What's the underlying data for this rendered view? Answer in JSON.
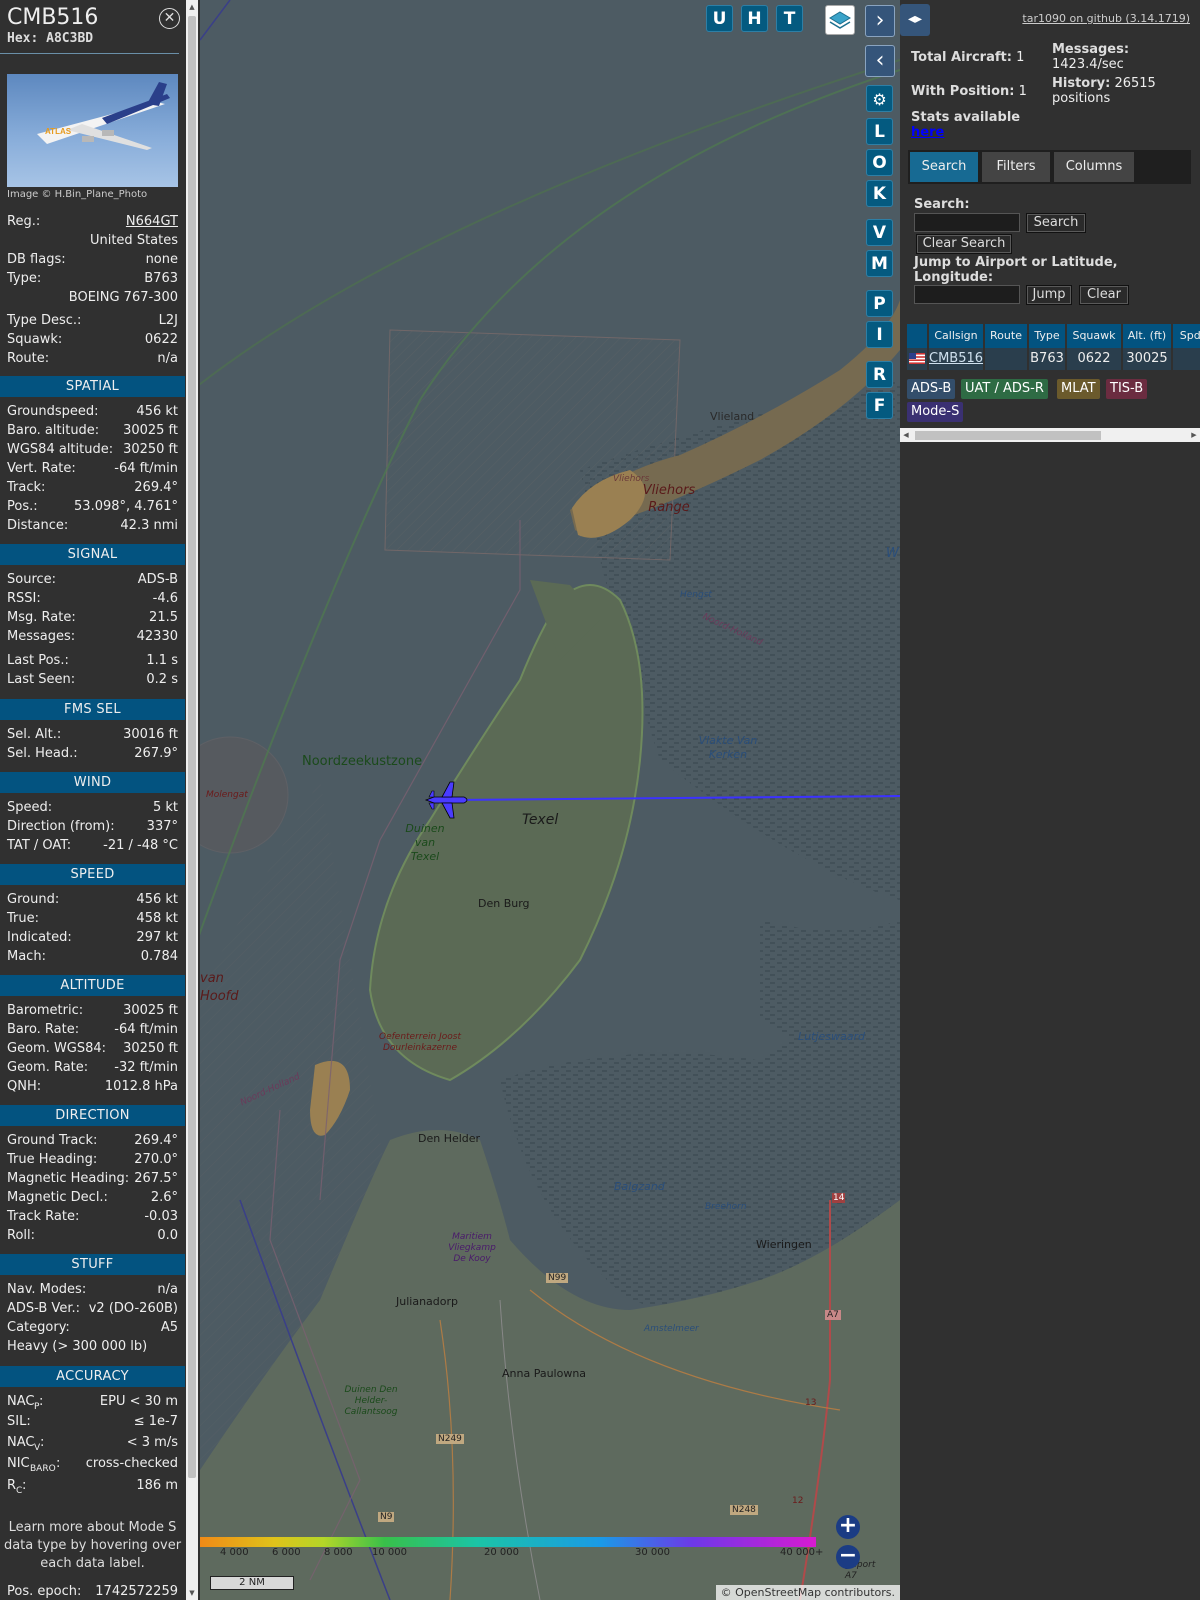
{
  "aircraft": {
    "callsign": "CMB516",
    "hex": "Hex: A8C3BD",
    "image_credit": "Image © H.Bin_Plane_Photo",
    "livery_text": "ATLAS"
  },
  "info_rows": {
    "reg": {
      "k": "Reg.:",
      "v": "N664GT"
    },
    "country": {
      "k": "",
      "v": "United States"
    },
    "dbflags": {
      "k": "DB flags:",
      "v": "none"
    },
    "type": {
      "k": "Type:",
      "v": "B763"
    },
    "type_name": {
      "k": "",
      "v": "BOEING 767-300"
    },
    "type_desc": {
      "k": "Type Desc.:",
      "v": "L2J"
    },
    "squawk": {
      "k": "Squawk:",
      "v": "0622"
    },
    "route": {
      "k": "Route:",
      "v": "n/a"
    }
  },
  "sections": {
    "spatial": "SPATIAL",
    "signal": "SIGNAL",
    "fms": "FMS SEL",
    "wind": "WIND",
    "speed": "SPEED",
    "altitude": "ALTITUDE",
    "direction": "DIRECTION",
    "stuff": "STUFF",
    "accuracy": "ACCURACY"
  },
  "spatial": [
    {
      "k": "Groundspeed:",
      "v": "456 kt"
    },
    {
      "k": "Baro. altitude:",
      "v": "30025 ft"
    },
    {
      "k": "WGS84 altitude:",
      "v": "30250 ft"
    },
    {
      "k": "Vert. Rate:",
      "v": "-64 ft/min"
    },
    {
      "k": "Track:",
      "v": "269.4°"
    },
    {
      "k": "Pos.:",
      "v": "53.098°, 4.761°"
    },
    {
      "k": "Distance:",
      "v": "42.3 nmi"
    }
  ],
  "signal": [
    {
      "k": "Source:",
      "v": "ADS-B"
    },
    {
      "k": "RSSI:",
      "v": "-4.6"
    },
    {
      "k": "Msg. Rate:",
      "v": "21.5"
    },
    {
      "k": "Messages:",
      "v": "42330"
    },
    {
      "k": "Last Pos.:",
      "v": "1.1 s"
    },
    {
      "k": "Last Seen:",
      "v": "0.2 s"
    }
  ],
  "fms": [
    {
      "k": "Sel. Alt.:",
      "v": "30016 ft"
    },
    {
      "k": "Sel. Head.:",
      "v": "267.9°"
    }
  ],
  "wind": [
    {
      "k": "Speed:",
      "v": "5 kt"
    },
    {
      "k": "Direction (from):",
      "v": "337°"
    },
    {
      "k": "TAT / OAT:",
      "v": "-21 / -48 °C"
    }
  ],
  "speed": [
    {
      "k": "Ground:",
      "v": "456 kt"
    },
    {
      "k": "True:",
      "v": "458 kt"
    },
    {
      "k": "Indicated:",
      "v": "297 kt"
    },
    {
      "k": "Mach:",
      "v": "0.784"
    }
  ],
  "altitude": [
    {
      "k": "Barometric:",
      "v": "30025 ft"
    },
    {
      "k": "Baro. Rate:",
      "v": "-64 ft/min"
    },
    {
      "k": "Geom. WGS84:",
      "v": "30250 ft"
    },
    {
      "k": "Geom. Rate:",
      "v": "-32 ft/min"
    },
    {
      "k": "QNH:",
      "v": "1012.8 hPa"
    }
  ],
  "direction": [
    {
      "k": "Ground Track:",
      "v": "269.4°"
    },
    {
      "k": "True Heading:",
      "v": "270.0°"
    },
    {
      "k": "Magnetic Heading:",
      "v": "267.5°"
    },
    {
      "k": "Magnetic Decl.:",
      "v": "2.6°"
    },
    {
      "k": "Track Rate:",
      "v": "-0.03"
    },
    {
      "k": "Roll:",
      "v": "0.0"
    }
  ],
  "stuff": [
    {
      "k": "Nav. Modes:",
      "v": "n/a"
    },
    {
      "k": "ADS-B Ver.:",
      "v": "v2 (DO-260B)"
    },
    {
      "k": "Category:",
      "v": "A5"
    },
    {
      "k": "Heavy (> 300 000 lb)",
      "v": ""
    }
  ],
  "accuracy": [
    {
      "k": "NAC",
      "sub": "P",
      "v": "EPU < 30 m"
    },
    {
      "k": "SIL:",
      "sub": "",
      "v": "≤ 1e-7"
    },
    {
      "k": "NAC",
      "sub": "V",
      "v": "< 3 m/s"
    },
    {
      "k": "NIC",
      "sub": "BARO",
      "v": "cross-checked"
    },
    {
      "k": "R",
      "sub": "C",
      "v": "186 m"
    }
  ],
  "learn_more": "Learn more about Mode S data type by hovering over each data label.",
  "pos_epoch": {
    "k": "Pos. epoch:",
    "v": "1742572259"
  },
  "map": {
    "buttons": [
      "U",
      "H",
      "T"
    ],
    "side_buttons": [
      "L",
      "O",
      "K",
      "V",
      "M",
      "P",
      "I",
      "R",
      "F"
    ],
    "labels": {
      "vlieland": "Vlieland",
      "vliehors": "Vliehors",
      "vliehors_range": "Vliehors Range",
      "hengst": "Hengst",
      "noord_holland": "Noord-Holland",
      "vlakte": "Vlakte Van Kerken",
      "noordzeekustzone": "Noordzeekustzone",
      "molengat": "Molengat",
      "texel": "Texel",
      "duinen_texel": "Duinen van Texel",
      "den_burg": "Den Burg",
      "van_hoofd": "van Hoofd",
      "oefenterrein": "Oefenterrein Joost Dourleinkazerne",
      "lutjeswaard": "Lutjeswaard",
      "noord_holland2": "Noord-Holland",
      "den_helder": "Den Helder",
      "balgzand": "Balgzand",
      "breehorn": "Breehorn",
      "wieringen": "Wieringen",
      "maritiem": "Maritiem Vliegkamp De Kooy",
      "n99": "N99",
      "julianadorp": "Julianadorp",
      "amstelmeer": "Amstelmeer",
      "a7": "A7",
      "anna_paulowna": "Anna Paulowna",
      "duinen_dh": "Duinen Den Helder-Callantsoog",
      "n249": "N249",
      "n9": "N9",
      "n248": "N248",
      "w": "W",
      "r14": "14",
      "r13": "13",
      "r12": "12",
      "griport": "griport A7"
    },
    "altitude_scale": [
      "4 000",
      "6 000",
      "8 000",
      "10 000",
      "20 000",
      "30 000",
      "40 000+"
    ],
    "scale": "2 NM",
    "attribution": "© OpenStreetMap contributors.",
    "colors": {
      "water": "#4d5b63",
      "land": "#5a6a58",
      "track": "#3c32ff",
      "plane": "#4a3cff"
    }
  },
  "side": {
    "github": "tar1090 on github (3.14.1719)",
    "total_aircraft": {
      "k": "Total Aircraft:",
      "v": "1"
    },
    "with_position": {
      "k": "With Position:",
      "v": "1"
    },
    "messages": {
      "k": "Messages:",
      "v": "1423.4/sec"
    },
    "history": {
      "k": "History:",
      "v": "26515 positions"
    },
    "stats": "Stats available",
    "stats_link": "here",
    "tabs": [
      "Search",
      "Filters",
      "Columns"
    ],
    "search_label": "Search:",
    "search_btn": "Search",
    "clear_search_btn": "Clear Search",
    "jump_label": "Jump to Airport or Latitude, Longitude:",
    "jump_btn": "Jump",
    "clear_btn": "Clear",
    "table": {
      "headers": [
        "",
        "Callsign",
        "Route",
        "Type",
        "Squawk",
        "Alt. (ft)",
        "Spd."
      ],
      "row": [
        "",
        "CMB516",
        "",
        "B763",
        "0622",
        "30025",
        ""
      ]
    },
    "badges": [
      {
        "label": "ADS-B",
        "color": "#334e6b"
      },
      {
        "label": "UAT / ADS-R",
        "color": "#2e6b44"
      },
      {
        "label": "MLAT",
        "color": "#6b5a2c"
      },
      {
        "label": "TIS-B",
        "color": "#6b2c40"
      },
      {
        "label": "Mode-S",
        "color": "#3a3072"
      }
    ]
  }
}
